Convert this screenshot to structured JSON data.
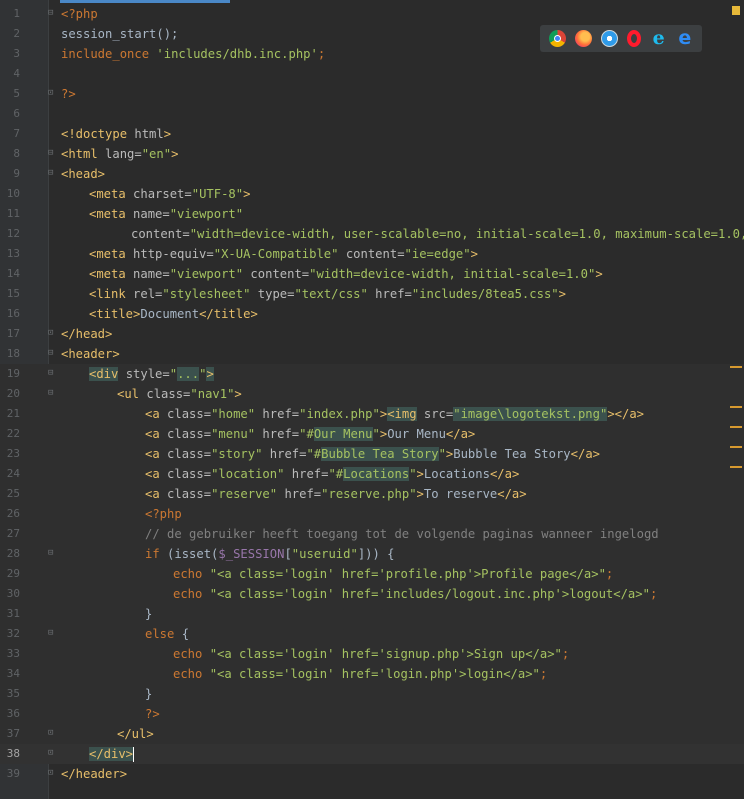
{
  "editor": {
    "lines": [
      {
        "n": "1"
      },
      {
        "n": "2"
      },
      {
        "n": "3"
      },
      {
        "n": "4"
      },
      {
        "n": "5"
      },
      {
        "n": "6"
      },
      {
        "n": "7"
      },
      {
        "n": "8"
      },
      {
        "n": "9"
      },
      {
        "n": "10"
      },
      {
        "n": "11"
      },
      {
        "n": "12"
      },
      {
        "n": "13"
      },
      {
        "n": "14"
      },
      {
        "n": "15"
      },
      {
        "n": "16"
      },
      {
        "n": "17"
      },
      {
        "n": "18"
      },
      {
        "n": "19"
      },
      {
        "n": "20"
      },
      {
        "n": "21"
      },
      {
        "n": "22"
      },
      {
        "n": "23"
      },
      {
        "n": "24"
      },
      {
        "n": "25"
      },
      {
        "n": "26"
      },
      {
        "n": "27"
      },
      {
        "n": "28"
      },
      {
        "n": "29"
      },
      {
        "n": "30"
      },
      {
        "n": "31"
      },
      {
        "n": "32"
      },
      {
        "n": "33"
      },
      {
        "n": "34"
      },
      {
        "n": "35"
      },
      {
        "n": "36"
      },
      {
        "n": "37"
      },
      {
        "n": "38"
      },
      {
        "n": "39"
      }
    ],
    "t": {
      "php_open": "<?php",
      "session_start": "session_start();",
      "include_once": "include_once",
      "include_path": "'includes/dhb.inc.php'",
      "semicolon": ";",
      "php_close": "?>",
      "doctype": "<!doctype",
      "html_word": " html",
      "gt": ">",
      "html_open": "<html",
      "lang_attr": " lang=",
      "lang_val": "\"en\"",
      "head_open": "<head>",
      "meta_open": "<meta",
      "charset_attr": " charset=",
      "charset_val": "\"UTF-8\"",
      "name_attr": " name=",
      "viewport_val": "\"viewport\"",
      "content_attr": "content=",
      "content_val_12": "\"width=device-width, user-scalable=no, initial-scale=1.0, maximum-scale=1.0, min",
      "http_equiv_attr": " http-equiv=",
      "xua_val": "\"X-UA-Compatible\"",
      "content_attr_sp": " content=",
      "ie_edge_val": "\"ie=edge\"",
      "content_val_14": "\"width=device-width, initial-scale=1.0\"",
      "link_open": "<link",
      "rel_attr": " rel=",
      "rel_val": "\"stylesheet\"",
      "type_attr": " type=",
      "type_val": "\"text/css\"",
      "href_attr": " href=",
      "css_val": "\"includes/8tea5.css\"",
      "title_open": "<title>",
      "title_text": "Document",
      "title_close": "</title>",
      "head_close": "</head>",
      "header_open": "<header>",
      "div_open": "<div",
      "style_attr": " style=",
      "quote": "\"",
      "ellipsis": "...",
      "div_gt": ">",
      "ul_open": "<ul",
      "class_attr": " class=",
      "nav1_val": "\"nav1\"",
      "a_open": "<a",
      "home_val": "\"home\"",
      "index_val": "\"index.php\"",
      "img_open": "<img",
      "src_attr": " src=",
      "img_val": "\"image\\logotekst.png\"",
      "a_close_gt": "></a>",
      "menu_val": "\"menu\"",
      "hash": "\"#",
      "our_menu": "Our Menu",
      "our_menu_text": "Our Menu",
      "a_close": "</a>",
      "story_val": "\"story\"",
      "bubble": "Bubble Tea Story",
      "bubble_text": "Bubble Tea Story",
      "location_val": "\"location\"",
      "locations": "Locations",
      "locations_text": "Locations",
      "reserve_val": "\"reserve\"",
      "reserve_href": "\"reserve.php\"",
      "reserve_text": "To reserve",
      "comment": "// de gebruiker heeft toegang tot de volgende paginas wanneer ingelogd",
      "if_kw": "if",
      "isset_open": " (isset(",
      "session_var": "$_SESSION",
      "bracket_open": "[",
      "useruid": "\"useruid\"",
      "if_close": "])) {",
      "echo_kw": "echo",
      "echo29": " \"<a class='login' href='profile.php'>Profile page</a>\"",
      "echo30": " \"<a class='login' href='includes/logout.inc.php'>logout</a>\"",
      "brace_close": "}",
      "else_kw": "else",
      "brace_open": " {",
      "echo33": " \"<a class='login' href='signup.php'>Sign up</a>\"",
      "echo34": " \"<a class='login' href='login.php'>login</a>\"",
      "ul_close": "</ul>",
      "div_close": "</div>",
      "header_close": "</header>"
    }
  },
  "browser_icons": [
    "chrome-icon",
    "firefox-icon",
    "safari-icon",
    "opera-icon",
    "ie-icon",
    "edge-icon"
  ],
  "colors": {
    "background": "#2b2b2b",
    "keyword": "#cc7832",
    "tag": "#e8bf6a",
    "string": "#a5c261",
    "comment": "#808080",
    "variable": "#9876aa",
    "text": "#a9b7c6"
  }
}
